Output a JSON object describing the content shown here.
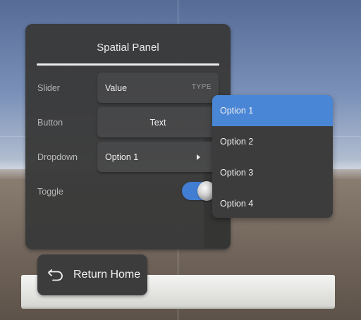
{
  "panel": {
    "title": "Spatial Panel",
    "rows": {
      "slider": {
        "label": "Slider",
        "value": "Value",
        "type_label": "TYPE"
      },
      "button": {
        "label": "Button",
        "text": "Text"
      },
      "dropdown": {
        "label": "Dropdown",
        "selected": "Option 1"
      },
      "toggle": {
        "label": "Toggle",
        "on": true
      }
    }
  },
  "dropdown_menu": {
    "options": [
      "Option 1",
      "Option 2",
      "Option 3",
      "Option 4"
    ],
    "selected_index": 0
  },
  "return_button": {
    "label": "Return Home",
    "icon": "return-arrow-icon"
  },
  "colors": {
    "accent": "#4a86d6",
    "panel_bg": "#3a3a3a",
    "control_bg": "#444444"
  }
}
